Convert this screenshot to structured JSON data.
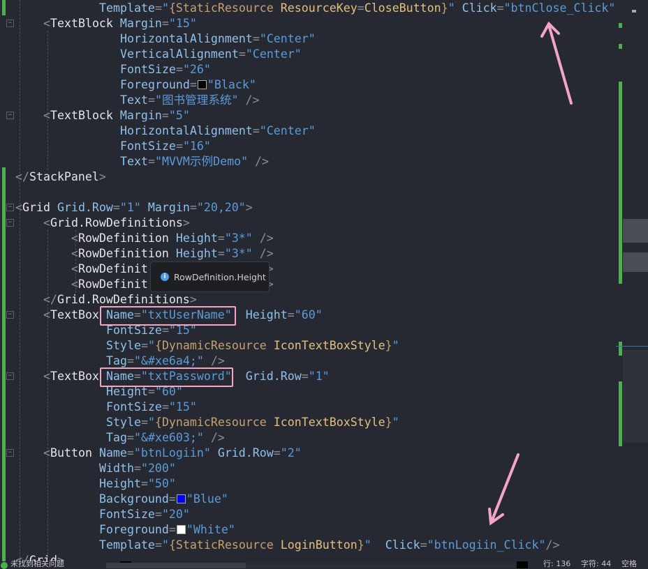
{
  "editor": {
    "lines": [
      {
        "indent": 12,
        "tokens": [
          [
            "a",
            "Template"
          ],
          [
            "p",
            "="
          ],
          [
            "v",
            "\""
          ],
          [
            "m",
            "{StaticResource "
          ],
          [
            "k",
            "ResourceKey"
          ],
          [
            "p",
            "="
          ],
          [
            "k",
            "CloseButton"
          ],
          [
            "m",
            "}"
          ],
          [
            "v",
            "\""
          ],
          [
            "p",
            " "
          ],
          [
            "a",
            "Click"
          ],
          [
            "p",
            "="
          ],
          [
            "v",
            "\"btnClose_Click\""
          ]
        ]
      },
      {
        "indent": 4,
        "tokens": [
          [
            "p",
            "<"
          ],
          [
            "t",
            "TextBlock"
          ],
          [
            "p",
            " "
          ],
          [
            "a",
            "Margin"
          ],
          [
            "p",
            "="
          ],
          [
            "v",
            "\"15\""
          ]
        ]
      },
      {
        "indent": 15,
        "tokens": [
          [
            "a",
            "HorizontalAlignment"
          ],
          [
            "p",
            "="
          ],
          [
            "v",
            "\"Center\""
          ]
        ]
      },
      {
        "indent": 15,
        "tokens": [
          [
            "a",
            "VerticalAlignment"
          ],
          [
            "p",
            "="
          ],
          [
            "v",
            "\"Center\""
          ]
        ]
      },
      {
        "indent": 15,
        "tokens": [
          [
            "a",
            "FontSize"
          ],
          [
            "p",
            "="
          ],
          [
            "v",
            "\"26\""
          ]
        ]
      },
      {
        "indent": 15,
        "tokens": [
          [
            "a",
            "Foreground"
          ],
          [
            "p",
            "="
          ],
          [
            "sw",
            "#000000"
          ],
          [
            "v",
            "\"Black\""
          ]
        ]
      },
      {
        "indent": 15,
        "tokens": [
          [
            "a",
            "Text"
          ],
          [
            "p",
            "="
          ],
          [
            "v",
            "\"图书管理系统\""
          ],
          [
            "p",
            " />"
          ]
        ]
      },
      {
        "indent": 4,
        "tokens": [
          [
            "p",
            "<"
          ],
          [
            "t",
            "TextBlock"
          ],
          [
            "p",
            " "
          ],
          [
            "a",
            "Margin"
          ],
          [
            "p",
            "="
          ],
          [
            "v",
            "\"5\""
          ]
        ]
      },
      {
        "indent": 15,
        "tokens": [
          [
            "a",
            "HorizontalAlignment"
          ],
          [
            "p",
            "="
          ],
          [
            "v",
            "\"Center\""
          ]
        ]
      },
      {
        "indent": 15,
        "tokens": [
          [
            "a",
            "FontSize"
          ],
          [
            "p",
            "="
          ],
          [
            "v",
            "\"16\""
          ]
        ]
      },
      {
        "indent": 15,
        "tokens": [
          [
            "a",
            "Text"
          ],
          [
            "p",
            "="
          ],
          [
            "v",
            "\"MVVM示例Demo\""
          ],
          [
            "p",
            " />"
          ]
        ]
      },
      {
        "indent": 0,
        "tokens": [
          [
            "p",
            "</"
          ],
          [
            "t",
            "StackPanel"
          ],
          [
            "p",
            ">"
          ]
        ]
      },
      {
        "indent": 0,
        "tokens": []
      },
      {
        "indent": 0,
        "tokens": [
          [
            "p",
            "<"
          ],
          [
            "t",
            "Grid"
          ],
          [
            "p",
            " "
          ],
          [
            "a",
            "Grid.Row"
          ],
          [
            "p",
            "="
          ],
          [
            "v",
            "\"1\""
          ],
          [
            "p",
            " "
          ],
          [
            "a",
            "Margin"
          ],
          [
            "p",
            "="
          ],
          [
            "v",
            "\"20,20\""
          ],
          [
            "p",
            ">"
          ]
        ]
      },
      {
        "indent": 4,
        "tokens": [
          [
            "p",
            "<"
          ],
          [
            "t",
            "Grid.RowDefinitions"
          ],
          [
            "p",
            ">"
          ]
        ]
      },
      {
        "indent": 8,
        "tokens": [
          [
            "p",
            "<"
          ],
          [
            "t",
            "RowDefinition"
          ],
          [
            "p",
            " "
          ],
          [
            "a",
            "Height"
          ],
          [
            "p",
            "="
          ],
          [
            "v",
            "\"3*\""
          ],
          [
            "p",
            " />"
          ]
        ]
      },
      {
        "indent": 8,
        "tokens": [
          [
            "p",
            "<"
          ],
          [
            "t",
            "RowDefinition"
          ],
          [
            "p",
            " "
          ],
          [
            "a",
            "Height"
          ],
          [
            "p",
            "="
          ],
          [
            "v",
            "\"3*\""
          ],
          [
            "p",
            " />"
          ]
        ]
      },
      {
        "indent": 8,
        "tokens": [
          [
            "p",
            "<"
          ],
          [
            "t",
            "RowDefinit"
          ],
          [
            "p",
            "                 >"
          ]
        ]
      },
      {
        "indent": 8,
        "tokens": [
          [
            "p",
            "<"
          ],
          [
            "t",
            "RowDefinit"
          ],
          [
            "p",
            "                 >"
          ]
        ]
      },
      {
        "indent": 4,
        "tokens": [
          [
            "p",
            "</"
          ],
          [
            "t",
            "Grid.RowDefinitions"
          ],
          [
            "p",
            ">"
          ]
        ]
      },
      {
        "indent": 4,
        "tokens": [
          [
            "p",
            "<"
          ],
          [
            "t",
            "TextBox"
          ],
          [
            "p",
            " "
          ],
          [
            "a",
            "Name"
          ],
          [
            "p",
            "="
          ],
          [
            "v",
            "\"txtUserName\""
          ],
          [
            "p",
            "  "
          ],
          [
            "a",
            "Height"
          ],
          [
            "p",
            "="
          ],
          [
            "v",
            "\"60\""
          ]
        ]
      },
      {
        "indent": 13,
        "tokens": [
          [
            "a",
            "FontSize"
          ],
          [
            "p",
            "="
          ],
          [
            "v",
            "\"15\""
          ]
        ]
      },
      {
        "indent": 13,
        "tokens": [
          [
            "a",
            "Style"
          ],
          [
            "p",
            "="
          ],
          [
            "v",
            "\""
          ],
          [
            "m",
            "{DynamicResource "
          ],
          [
            "k",
            "IconTextBoxStyle"
          ],
          [
            "m",
            "}"
          ],
          [
            "v",
            "\""
          ]
        ]
      },
      {
        "indent": 13,
        "tokens": [
          [
            "a",
            "Tag"
          ],
          [
            "p",
            "="
          ],
          [
            "v",
            "\"&#xe6a4;\""
          ],
          [
            "p",
            " />"
          ]
        ]
      },
      {
        "indent": 4,
        "tokens": [
          [
            "p",
            "<"
          ],
          [
            "t",
            "TextBox"
          ],
          [
            "p",
            " "
          ],
          [
            "a",
            "Name"
          ],
          [
            "p",
            "="
          ],
          [
            "v",
            "\"txtPassword\""
          ],
          [
            "p",
            "  "
          ],
          [
            "a",
            "Grid.Row"
          ],
          [
            "p",
            "="
          ],
          [
            "v",
            "\"1\""
          ]
        ]
      },
      {
        "indent": 13,
        "tokens": [
          [
            "a",
            "Height"
          ],
          [
            "p",
            "="
          ],
          [
            "v",
            "\"60\""
          ]
        ]
      },
      {
        "indent": 13,
        "tokens": [
          [
            "a",
            "FontSize"
          ],
          [
            "p",
            "="
          ],
          [
            "v",
            "\"15\""
          ]
        ]
      },
      {
        "indent": 13,
        "tokens": [
          [
            "a",
            "Style"
          ],
          [
            "p",
            "="
          ],
          [
            "v",
            "\""
          ],
          [
            "m",
            "{DynamicResource "
          ],
          [
            "k",
            "IconTextBoxStyle"
          ],
          [
            "m",
            "}"
          ],
          [
            "v",
            "\""
          ]
        ]
      },
      {
        "indent": 13,
        "tokens": [
          [
            "a",
            "Tag"
          ],
          [
            "p",
            "="
          ],
          [
            "v",
            "\"&#xe603;\""
          ],
          [
            "p",
            " />"
          ]
        ]
      },
      {
        "indent": 4,
        "tokens": [
          [
            "p",
            "<"
          ],
          [
            "t",
            "Button"
          ],
          [
            "p",
            " "
          ],
          [
            "a",
            "Name"
          ],
          [
            "p",
            "="
          ],
          [
            "v",
            "\"btnLogiin\""
          ],
          [
            "p",
            " "
          ],
          [
            "a",
            "Grid.Row"
          ],
          [
            "p",
            "="
          ],
          [
            "v",
            "\"2\""
          ]
        ]
      },
      {
        "indent": 12,
        "tokens": [
          [
            "a",
            "Width"
          ],
          [
            "p",
            "="
          ],
          [
            "v",
            "\"200\""
          ]
        ]
      },
      {
        "indent": 12,
        "tokens": [
          [
            "a",
            "Height"
          ],
          [
            "p",
            "="
          ],
          [
            "v",
            "\"50\""
          ]
        ]
      },
      {
        "indent": 12,
        "tokens": [
          [
            "a",
            "Background"
          ],
          [
            "p",
            "="
          ],
          [
            "sw",
            "#0000ff"
          ],
          [
            "v",
            "\"Blue\""
          ]
        ]
      },
      {
        "indent": 12,
        "tokens": [
          [
            "a",
            "FontSize"
          ],
          [
            "p",
            "="
          ],
          [
            "v",
            "\"20\""
          ]
        ]
      },
      {
        "indent": 12,
        "tokens": [
          [
            "a",
            "Foreground"
          ],
          [
            "p",
            "="
          ],
          [
            "sw",
            "#ffffff"
          ],
          [
            "v",
            "\"White\""
          ]
        ]
      },
      {
        "indent": 12,
        "tokens": [
          [
            "a",
            "Template"
          ],
          [
            "p",
            "="
          ],
          [
            "v",
            "\""
          ],
          [
            "m",
            "{StaticResource "
          ],
          [
            "k",
            "LoginButton"
          ],
          [
            "m",
            "}"
          ],
          [
            "v",
            "\""
          ],
          [
            "p",
            "  "
          ],
          [
            "a",
            "Click"
          ],
          [
            "p",
            "="
          ],
          [
            "v",
            "\"btnLogiin_Click\""
          ],
          [
            "p",
            "/>"
          ]
        ]
      },
      {
        "indent": 0,
        "tokens": [
          [
            "p",
            "</"
          ],
          [
            "t",
            "Grid"
          ],
          [
            "p",
            ">"
          ]
        ]
      }
    ]
  },
  "tooltip": {
    "icon": "info-icon",
    "text": "RowDefinition.Height"
  },
  "status": {
    "issues": "未找到相关问题",
    "line": "行: 136",
    "char": "字符: 44",
    "spaces": "空格",
    "ok_icon": "check-circle-icon"
  },
  "colors": {
    "annotation": "#f2a6c4",
    "change_bar": "#4caf50",
    "background": "#262932"
  }
}
